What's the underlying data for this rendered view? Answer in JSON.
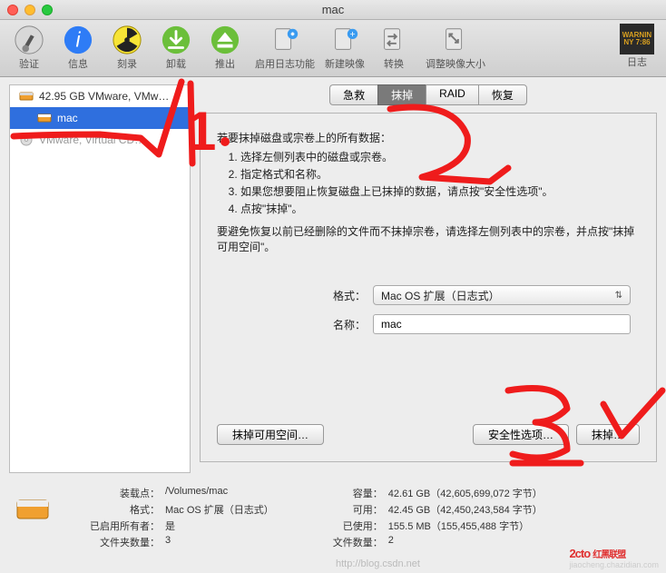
{
  "window": {
    "title": "mac"
  },
  "toolbar": {
    "items": [
      {
        "label": "验证",
        "icon": "microscope"
      },
      {
        "label": "信息",
        "icon": "info"
      },
      {
        "label": "刻录",
        "icon": "radiation"
      },
      {
        "label": "卸载",
        "icon": "unmount"
      },
      {
        "label": "推出",
        "icon": "eject"
      },
      {
        "label": "启用日志功能",
        "icon": "log-start"
      },
      {
        "label": "新建映像",
        "icon": "new-image"
      },
      {
        "label": "转换",
        "icon": "convert"
      },
      {
        "label": "调整映像大小",
        "icon": "resize-image"
      }
    ],
    "log_label": "日志"
  },
  "sidebar": {
    "items": [
      {
        "label": "42.95 GB VMware, VMw…",
        "type": "disk"
      },
      {
        "label": "mac",
        "type": "volume",
        "selected": true
      },
      {
        "label": "VMware, Virtual CD…",
        "type": "disk",
        "dim": true
      }
    ]
  },
  "tabs": [
    "急救",
    "抹掉",
    "RAID",
    "恢复"
  ],
  "active_tab": "抹掉",
  "erase_panel": {
    "intro_head": "若要抹掉磁盘或宗卷上的所有数据：",
    "steps": [
      "选择左侧列表中的磁盘或宗卷。",
      "指定格式和名称。",
      "如果您想要阻止恢复磁盘上已抹掉的数据，请点按\"安全性选项\"。",
      "点按\"抹掉\"。"
    ],
    "intro_foot": "要避免恢复以前已经删除的文件而不抹掉宗卷，请选择左侧列表中的宗卷，并点按\"抹掉可用空间\"。",
    "format_label": "格式：",
    "format_value": "Mac OS 扩展（日志式）",
    "name_label": "名称：",
    "name_value": "mac",
    "btn_free": "抹掉可用空间…",
    "btn_secopt": "安全性选项…",
    "btn_erase": "抹掉…"
  },
  "footer": {
    "left": [
      {
        "k": "装载点：",
        "v": "/Volumes/mac"
      },
      {
        "k": "格式：",
        "v": "Mac OS 扩展（日志式）"
      },
      {
        "k": "已启用所有者：",
        "v": "是"
      },
      {
        "k": "文件夹数量：",
        "v": "3"
      }
    ],
    "right": [
      {
        "k": "容量：",
        "v": "42.61 GB（42,605,699,072 字节）"
      },
      {
        "k": "可用：",
        "v": "42.45 GB（42,450,243,584 字节）"
      },
      {
        "k": "已使用：",
        "v": "155.5 MB（155,455,488 字节）"
      },
      {
        "k": "文件数量：",
        "v": "2"
      }
    ]
  },
  "overlay": {
    "marks": [
      "1✓",
      "2",
      "3✓"
    ],
    "watermark_brand": "2cto",
    "watermark_brand_cn": "红黑联盟",
    "watermark_domain": "jiaocheng.chazidian.com",
    "csdn": "http://blog.csdn.net"
  }
}
